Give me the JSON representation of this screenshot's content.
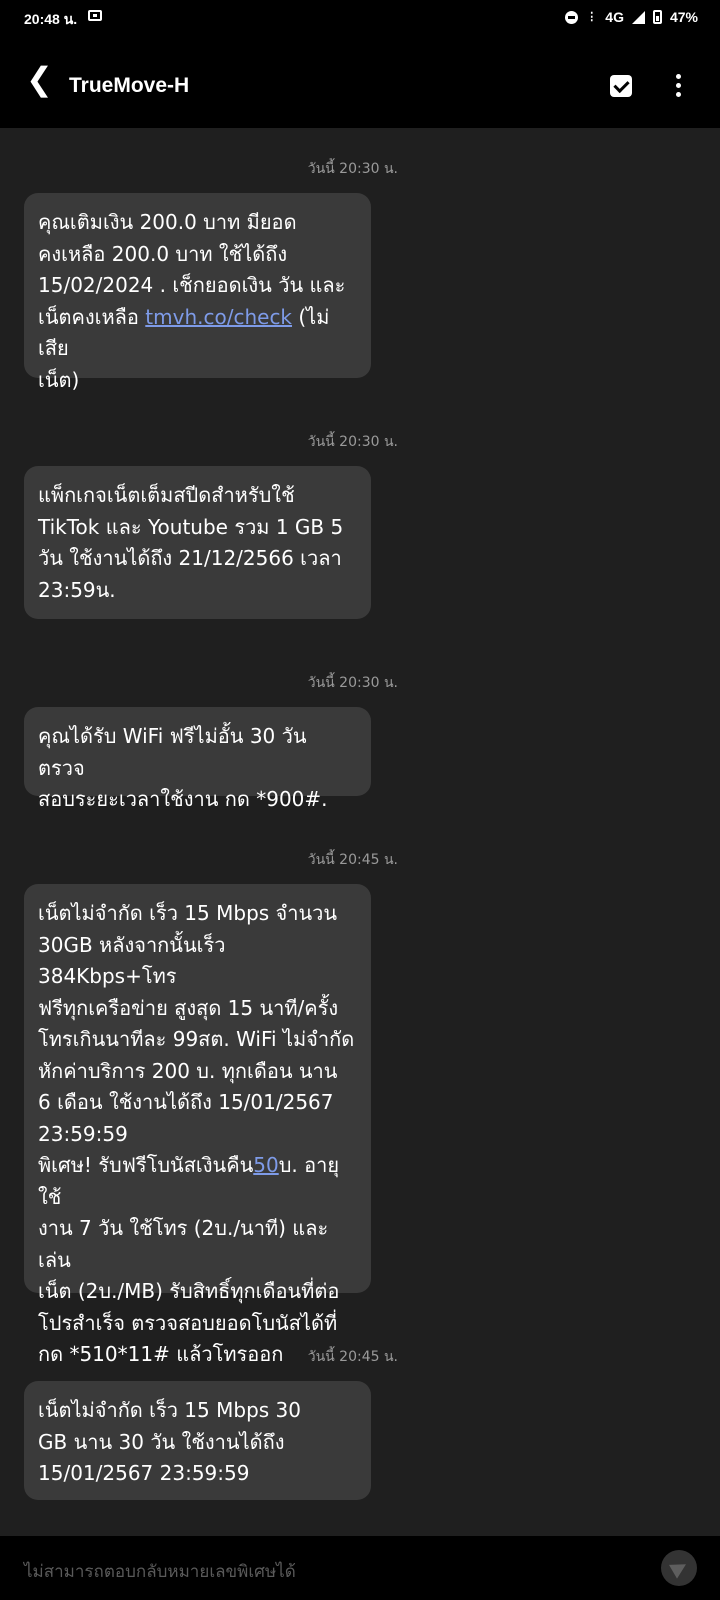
{
  "status_bar": {
    "time": "20:48 น.",
    "network": "4G",
    "battery": "47%",
    "icons": [
      "gallery-icon",
      "dnd-icon",
      "volte-icon",
      "signal-icon",
      "battery-icon"
    ]
  },
  "header": {
    "title": "TrueMove-H",
    "icons": [
      "back-icon",
      "select-check-icon",
      "more-options-icon"
    ]
  },
  "messages": [
    {
      "timestamp": "วันนี้ 20:30 น.",
      "text_before": "คุณเติมเงิน 200.0 บาท มียอด\nคงเหลือ 200.0 บาท ใช้ได้ถึง\n15/02/2024 . เช็กยอดเงิน วัน และ\nเน็ตคงเหลือ ",
      "link": "tmvh.co/check",
      "text_after": " (ไม่เสีย\nเน็ต)"
    },
    {
      "timestamp": "วันนี้ 20:30 น.",
      "text": "แพ็กเกจเน็ตเต็มสปีดสำหรับใช้\nTikTok และ Youtube รวม 1 GB 5\nวัน ใช้งานได้ถึง 21/12/2566 เวลา\n23:59น."
    },
    {
      "timestamp": "วันนี้ 20:30 น.",
      "text": "คุณได้รับ WiFi ฟรีไม่อั้น 30 วัน ตรวจ\nสอบระยะเวลาใช้งาน กด *900#."
    },
    {
      "timestamp": "วันนี้ 20:45 น.",
      "text_before": "เน็ตไม่จำกัด เร็ว 15 Mbps จำนวน\n30GB หลังจากนั้นเร็ว 384Kbps+โทร\nฟรีทุกเครือข่าย สูงสุด 15 นาที/ครั้ง\nโทรเกินนาทีละ 99สต. WiFi ไม่จำกัด\nหักค่าบริการ 200 บ. ทุกเดือน นาน\n6 เดือน ใช้งานได้ถึง 15/01/2567\n23:59:59\nพิเศษ! รับฟรีโบนัสเงินคืน",
      "link": "50",
      "text_after": "บ. อายุใช้\nงาน 7 วัน ใช้โทร (2บ./นาที) และเล่น\nเน็ต (2บ./MB) รับสิทธิ์ทุกเดือนที่ต่อ\nโปรสำเร็จ ตรวจสอบยอดโบนัสได้ที่\nกด *510*11# แล้วโทรออก"
    },
    {
      "timestamp": "วันนี้ 20:45 น.",
      "text": "เน็ตไม่จำกัด เร็ว 15 Mbps 30\nGB นาน 30 วัน ใช้งานได้ถึง\n15/01/2567 23:59:59"
    }
  ],
  "composer": {
    "placeholder": "ไม่สามารถตอบกลับหมายเลขพิเศษได้",
    "send_icon": "send-icon"
  }
}
